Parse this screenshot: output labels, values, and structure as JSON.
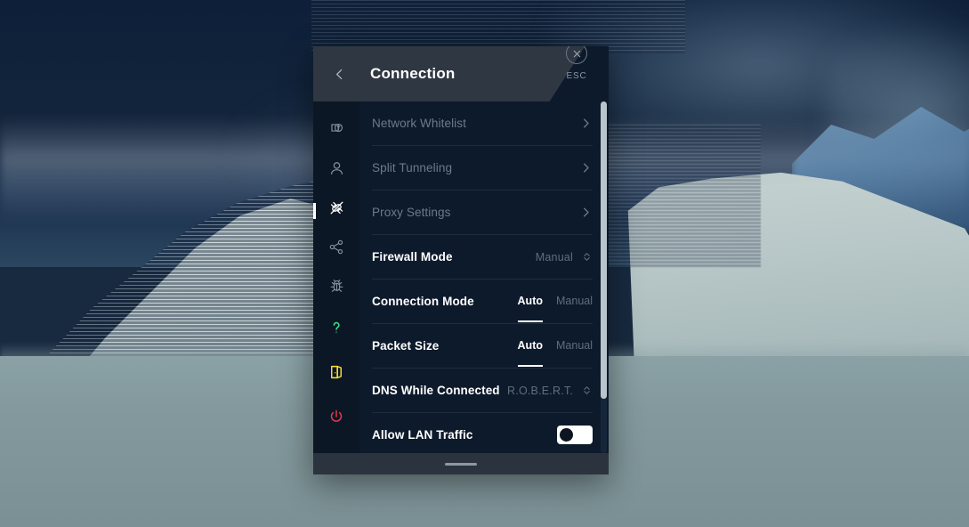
{
  "panel": {
    "title": "Connection",
    "back_icon": "chevron-left-icon",
    "esc": {
      "label": "ESC",
      "icon": "close-x-icon"
    }
  },
  "sidebar": {
    "items": [
      {
        "name": "general",
        "icon": "location-pin-icon",
        "active": false
      },
      {
        "name": "account",
        "icon": "user-icon",
        "active": false
      },
      {
        "name": "connection",
        "icon": "plug-disconnect-icon",
        "active": true
      },
      {
        "name": "network-sharing",
        "icon": "share-nodes-icon",
        "active": false
      },
      {
        "name": "advanced",
        "icon": "bug-icon",
        "active": false
      }
    ],
    "bottom_items": [
      {
        "name": "help",
        "icon": "question-mark-icon",
        "color": "#3ddc84"
      },
      {
        "name": "logout-door",
        "icon": "exit-door-icon",
        "color": "#ffe234"
      },
      {
        "name": "power",
        "icon": "power-icon",
        "color": "#e03a4a"
      }
    ]
  },
  "settings": {
    "rows": [
      {
        "label": "Network Whitelist",
        "type": "navigation",
        "disabled": true,
        "icon": "chevron-right-icon"
      },
      {
        "label": "Split Tunneling",
        "type": "navigation",
        "disabled": true,
        "icon": "chevron-right-icon"
      },
      {
        "label": "Proxy Settings",
        "type": "navigation",
        "disabled": true,
        "icon": "chevron-right-icon"
      },
      {
        "label": "Firewall Mode",
        "type": "select",
        "disabled": false,
        "value": "Manual",
        "icon": "chevron-updown-icon"
      },
      {
        "label": "Connection Mode",
        "type": "segmented",
        "disabled": false,
        "options": [
          "Auto",
          "Manual"
        ],
        "selected": "Auto"
      },
      {
        "label": "Packet Size",
        "type": "segmented",
        "disabled": false,
        "options": [
          "Auto",
          "Manual"
        ],
        "selected": "Auto"
      },
      {
        "label": "DNS While Connected",
        "type": "select",
        "disabled": false,
        "value": "R.O.B.E.R.T.",
        "icon": "chevron-updown-icon"
      },
      {
        "label": "Allow LAN Traffic",
        "type": "toggle",
        "disabled": false,
        "on": false
      }
    ]
  },
  "colors": {
    "panel_bg": "#0d1a2b",
    "rail_bg": "#0c1726",
    "header_bg": "#2f3742",
    "footer_bg": "#2b333e",
    "text_primary": "#ffffff",
    "text_dim": "#6c7a8a",
    "scrollbar": "#b9c4cd"
  }
}
